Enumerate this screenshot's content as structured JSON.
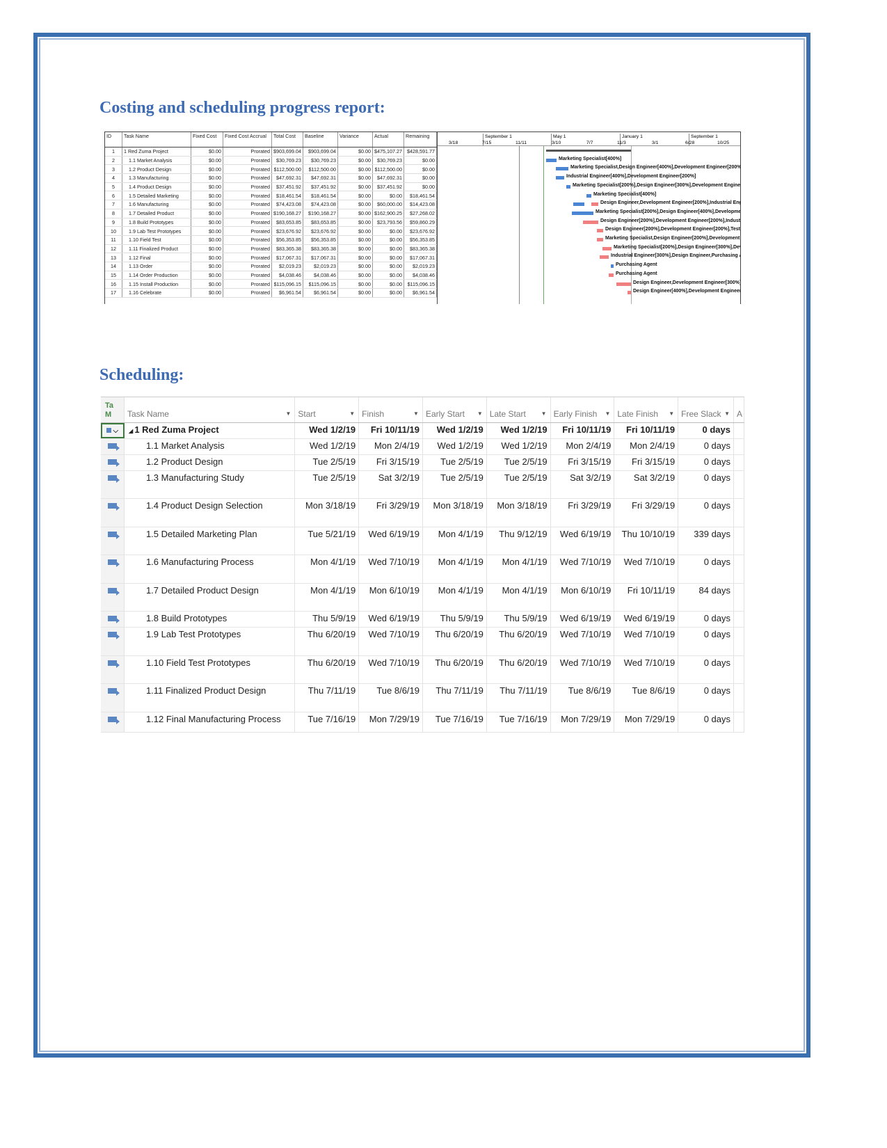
{
  "headings": {
    "costing": "Costing and scheduling progress report:",
    "scheduling": "Scheduling:"
  },
  "cost_table": {
    "columns": [
      "ID",
      "Task Name",
      "Fixed Cost",
      "Fixed Cost Accrual",
      "Total Cost",
      "Baseline",
      "Variance",
      "Actual",
      "Remaining"
    ],
    "rows": [
      [
        "1",
        "1 Red Zuma Project",
        "$0.00",
        "Prorated",
        "$903,699.04",
        "$903,699.04",
        "$0.00",
        "$475,107.27",
        "$428,591.77"
      ],
      [
        "2",
        "1.1 Market Analysis",
        "$0.00",
        "Prorated",
        "$30,769.23",
        "$30,769.23",
        "$0.00",
        "$30,769.23",
        "$0.00"
      ],
      [
        "3",
        "1.2 Product Design",
        "$0.00",
        "Prorated",
        "$112,500.00",
        "$112,500.00",
        "$0.00",
        "$112,500.00",
        "$0.00"
      ],
      [
        "4",
        "1.3 Manufacturing",
        "$0.00",
        "Prorated",
        "$47,692.31",
        "$47,692.31",
        "$0.00",
        "$47,692.31",
        "$0.00"
      ],
      [
        "5",
        "1.4 Product Design",
        "$0.00",
        "Prorated",
        "$37,451.92",
        "$37,451.92",
        "$0.00",
        "$37,451.92",
        "$0.00"
      ],
      [
        "6",
        "1.5 Detailed Marketing",
        "$0.00",
        "Prorated",
        "$18,461.54",
        "$18,461.54",
        "$0.00",
        "$0.00",
        "$18,461.54"
      ],
      [
        "7",
        "1.6 Manufacturing",
        "$0.00",
        "Prorated",
        "$74,423.08",
        "$74,423.08",
        "$0.00",
        "$60,000.00",
        "$14,423.08"
      ],
      [
        "8",
        "1.7 Detailed Product",
        "$0.00",
        "Prorated",
        "$190,168.27",
        "$190,168.27",
        "$0.00",
        "$162,900.25",
        "$27,268.02"
      ],
      [
        "9",
        "1.8 Build Prototypes",
        "$0.00",
        "Prorated",
        "$83,653.85",
        "$83,653.85",
        "$0.00",
        "$23,793.56",
        "$59,860.29"
      ],
      [
        "10",
        "1.9 Lab Test Prototypes",
        "$0.00",
        "Prorated",
        "$23,676.92",
        "$23,676.92",
        "$0.00",
        "$0.00",
        "$23,676.92"
      ],
      [
        "11",
        "1.10 Field Test",
        "$0.00",
        "Prorated",
        "$56,353.85",
        "$56,353.85",
        "$0.00",
        "$0.00",
        "$56,353.85"
      ],
      [
        "12",
        "1.11 Finalized Product",
        "$0.00",
        "Prorated",
        "$83,365.38",
        "$83,365.38",
        "$0.00",
        "$0.00",
        "$83,365.38"
      ],
      [
        "13",
        "1.12 Final",
        "$0.00",
        "Prorated",
        "$17,067.31",
        "$17,067.31",
        "$0.00",
        "$0.00",
        "$17,067.31"
      ],
      [
        "14",
        "1.13 Order",
        "$0.00",
        "Prorated",
        "$2,019.23",
        "$2,019.23",
        "$0.00",
        "$0.00",
        "$2,019.23"
      ],
      [
        "15",
        "1.14 Order Production",
        "$0.00",
        "Prorated",
        "$4,038.46",
        "$4,038.46",
        "$0.00",
        "$0.00",
        "$4,038.46"
      ],
      [
        "16",
        "1.15 Install Production",
        "$0.00",
        "Prorated",
        "$115,096.15",
        "$115,096.15",
        "$0.00",
        "$0.00",
        "$115,096.15"
      ],
      [
        "17",
        "1.16 Celebrate",
        "$0.00",
        "Prorated",
        "$6,961.54",
        "$6,961.54",
        "$0.00",
        "$0.00",
        "$6,961.54"
      ]
    ]
  },
  "gantt": {
    "top_scale": [
      "September 1",
      "May 1",
      "January 1",
      "September 1"
    ],
    "bottom_scale": [
      "3/18",
      "7/15",
      "11/11",
      "3/10",
      "7/7",
      "11/3",
      "3/1",
      "6/28",
      "10/25"
    ],
    "resource_labels": [
      "",
      "Marketing Specialist[400%]",
      "Marketing Specialist,Design Engineer[400%],Development Engineer[200%",
      "Industrial Engineer[400%],Development Engineer[200%]",
      "Marketing Specialist[200%],Design Engineer[300%],Development Engine",
      "Marketing Specialist[400%]",
      "Design Engineer,Development Engineer[200%],Industrial Engi",
      "Marketing Specialist[200%],Design Engineer[400%],Development",
      "Design Engineer[200%],Development Engineer[200%],Industrial",
      "Design Engineer[200%],Development Engineer[200%],Test Ri",
      "Marketing Specialist,Design Engineer[200%],Development En",
      "Marketing Specialist[200%],Design Engineer[300%],Develo",
      "Industrial Engineer[300%],Design Engineer,Purchasing Agen",
      "Purchasing Agent",
      "Purchasing Agent",
      "Design Engineer,Development Engineer[300%],Indu",
      "Design Engineer[400%],Development Engineer[400%"
    ],
    "colors": {
      "completed": "#4a86d4",
      "critical": "#f08080",
      "summary": "#555555"
    }
  },
  "schedule": {
    "mode_header": [
      "Ta",
      "M"
    ],
    "columns": [
      "Task Name",
      "Start",
      "Finish",
      "Early Start",
      "Late Start",
      "Early Finish",
      "Late Finish",
      "Free Slack",
      "A"
    ],
    "rows": [
      [
        "1 Red Zuma Project",
        "Wed 1/2/19",
        "Fri 10/11/19",
        "Wed 1/2/19",
        "Wed 1/2/19",
        "Fri 10/11/19",
        "Fri 10/11/19",
        "0 days"
      ],
      [
        "1.1 Market Analysis",
        "Wed 1/2/19",
        "Mon 2/4/19",
        "Wed 1/2/19",
        "Wed 1/2/19",
        "Mon 2/4/19",
        "Mon 2/4/19",
        "0 days"
      ],
      [
        "1.2 Product Design",
        "Tue 2/5/19",
        "Fri 3/15/19",
        "Tue 2/5/19",
        "Tue 2/5/19",
        "Fri 3/15/19",
        "Fri 3/15/19",
        "0 days"
      ],
      [
        "1.3 Manufacturing Study",
        "Tue 2/5/19",
        "Sat 3/2/19",
        "Tue 2/5/19",
        "Tue 2/5/19",
        "Sat 3/2/19",
        "Sat 3/2/19",
        "0 days"
      ],
      [
        "1.4 Product Design Selection",
        "Mon 3/18/19",
        "Fri 3/29/19",
        "Mon 3/18/19",
        "Mon 3/18/19",
        "Fri 3/29/19",
        "Fri 3/29/19",
        "0 days"
      ],
      [
        "1.5 Detailed Marketing Plan",
        "Tue 5/21/19",
        "Wed 6/19/19",
        "Mon 4/1/19",
        "Thu 9/12/19",
        "Wed 6/19/19",
        "Thu 10/10/19",
        "339 days"
      ],
      [
        "1.6 Manufacturing Process",
        "Mon 4/1/19",
        "Wed 7/10/19",
        "Mon 4/1/19",
        "Mon 4/1/19",
        "Wed 7/10/19",
        "Wed 7/10/19",
        "0 days"
      ],
      [
        "1.7 Detailed Product Design",
        "Mon 4/1/19",
        "Mon 6/10/19",
        "Mon 4/1/19",
        "Mon 4/1/19",
        "Mon 6/10/19",
        "Fri 10/11/19",
        "84 days"
      ],
      [
        "1.8 Build Prototypes",
        "Thu 5/9/19",
        "Wed 6/19/19",
        "Thu 5/9/19",
        "Thu 5/9/19",
        "Wed 6/19/19",
        "Wed 6/19/19",
        "0 days"
      ],
      [
        "1.9 Lab Test Prototypes",
        "Thu 6/20/19",
        "Wed 7/10/19",
        "Thu 6/20/19",
        "Thu 6/20/19",
        "Wed 7/10/19",
        "Wed 7/10/19",
        "0 days"
      ],
      [
        "1.10 Field Test Prototypes",
        "Thu 6/20/19",
        "Wed 7/10/19",
        "Thu 6/20/19",
        "Thu 6/20/19",
        "Wed 7/10/19",
        "Wed 7/10/19",
        "0 days"
      ],
      [
        "1.11 Finalized Product Design",
        "Thu 7/11/19",
        "Tue 8/6/19",
        "Thu 7/11/19",
        "Thu 7/11/19",
        "Tue 8/6/19",
        "Tue 8/6/19",
        "0 days"
      ],
      [
        "1.12 Final Manufacturing Process",
        "Tue 7/16/19",
        "Mon 7/29/19",
        "Tue 7/16/19",
        "Tue 7/16/19",
        "Mon 7/29/19",
        "Mon 7/29/19",
        "0 days"
      ]
    ]
  }
}
